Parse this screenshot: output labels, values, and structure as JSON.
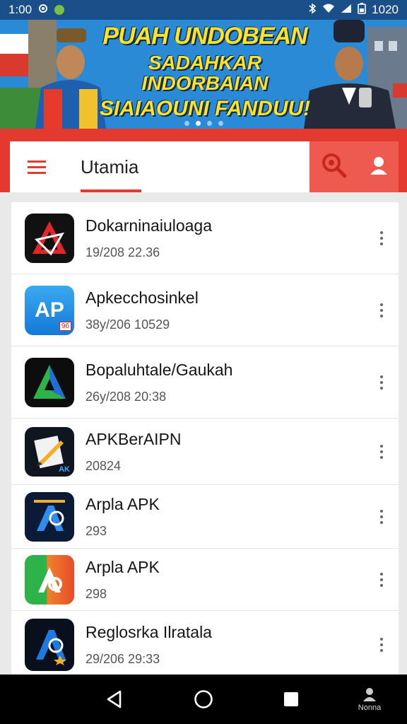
{
  "status_bar": {
    "time_left": "1:00",
    "time_right": "1020"
  },
  "banner": {
    "line1": "PUAH UNDOBEAN",
    "line2": "SADAHKAR INDORBAIAN",
    "line3": "SIAIAOUNI FANDUU!",
    "pages": 4,
    "active_page": 2
  },
  "header": {
    "tab_label": "Utamia",
    "menu_icon": "hamburger-menu-icon",
    "search_icon": "search-icon",
    "profile_icon": "user-icon",
    "accent_color": "#e3392f"
  },
  "apps": [
    {
      "name": "Dokarninaiuloaga",
      "meta": "19/208 22.36",
      "icon": "red-triangle-logo-icon"
    },
    {
      "name": "Apkecchosinkel",
      "meta": "38y/206 10529",
      "icon": "ap-blue-square-icon",
      "icon_text": "AP",
      "icon_badge": "96"
    },
    {
      "name": "Bopaluhtale/Gaukah",
      "meta": "26y/208 20:38",
      "icon": "green-blue-a-logo-icon"
    },
    {
      "name": "APKBerAIPN",
      "meta": "20824",
      "icon": "pencil-paper-icon",
      "icon_badge": "AK"
    },
    {
      "name": "Arpla APK",
      "meta": "293",
      "icon": "blue-ap-dark-icon"
    },
    {
      "name": "Arpla APK",
      "meta": "298",
      "icon": "orange-green-a-icon"
    },
    {
      "name": "Reglosrka Ilratala",
      "meta": "29/206 29:33",
      "icon": "blue-ap-star-icon"
    }
  ],
  "nav": {
    "profile_label": "Nonna",
    "back_icon": "back-triangle-icon",
    "home_icon": "home-circle-icon",
    "recents_icon": "recents-square-icon"
  }
}
